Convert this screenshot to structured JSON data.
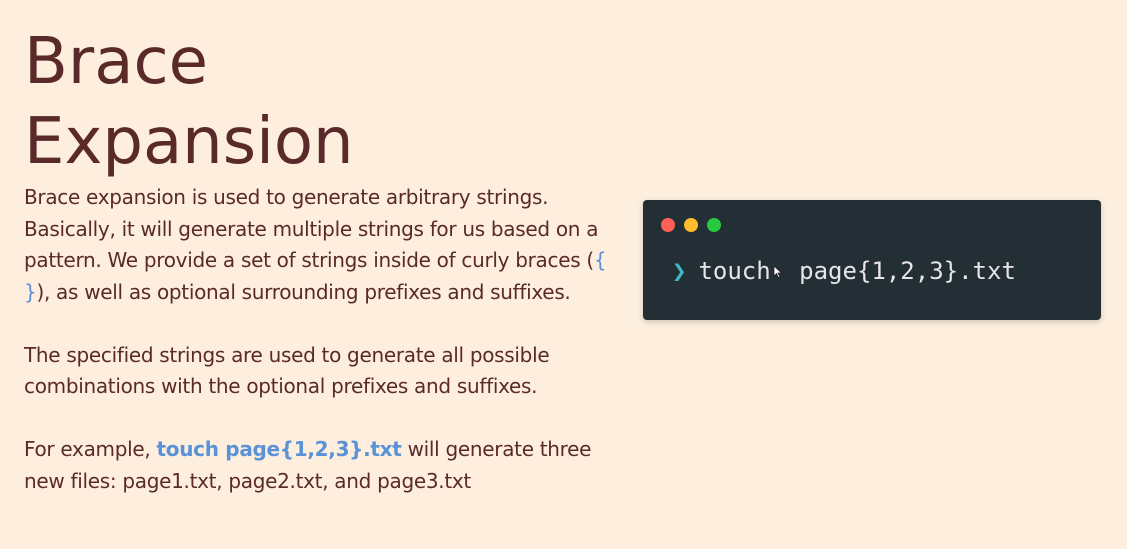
{
  "slide": {
    "title_line1": "Brace",
    "title_line2": "Expansion",
    "paragraphs": {
      "p1": {
        "before": "Brace expansion is used to generate arbitrary strings. Basically, it will generate multiple strings for us based on a pattern.  We provide a set of strings inside of curly braces (",
        "highlight": "{ }",
        "after": "), as well as optional surrounding prefixes and suffixes."
      },
      "p2": "The specified strings are used to generate all possible combinations with the optional prefixes and suffixes.",
      "p3": {
        "before": "For example, ",
        "highlight": "touch page{1,2,3}.txt",
        "after": " will generate three new files: page1.txt, page2.txt, and page3.txt"
      }
    }
  },
  "terminal": {
    "dots": [
      "#ff5f57",
      "#febc2e",
      "#28c840"
    ],
    "prompt_icon": "chevron-right-icon",
    "prompt_glyph": "❯",
    "command_part1": "touch",
    "command_part2": " page{1,2,3}.txt"
  }
}
